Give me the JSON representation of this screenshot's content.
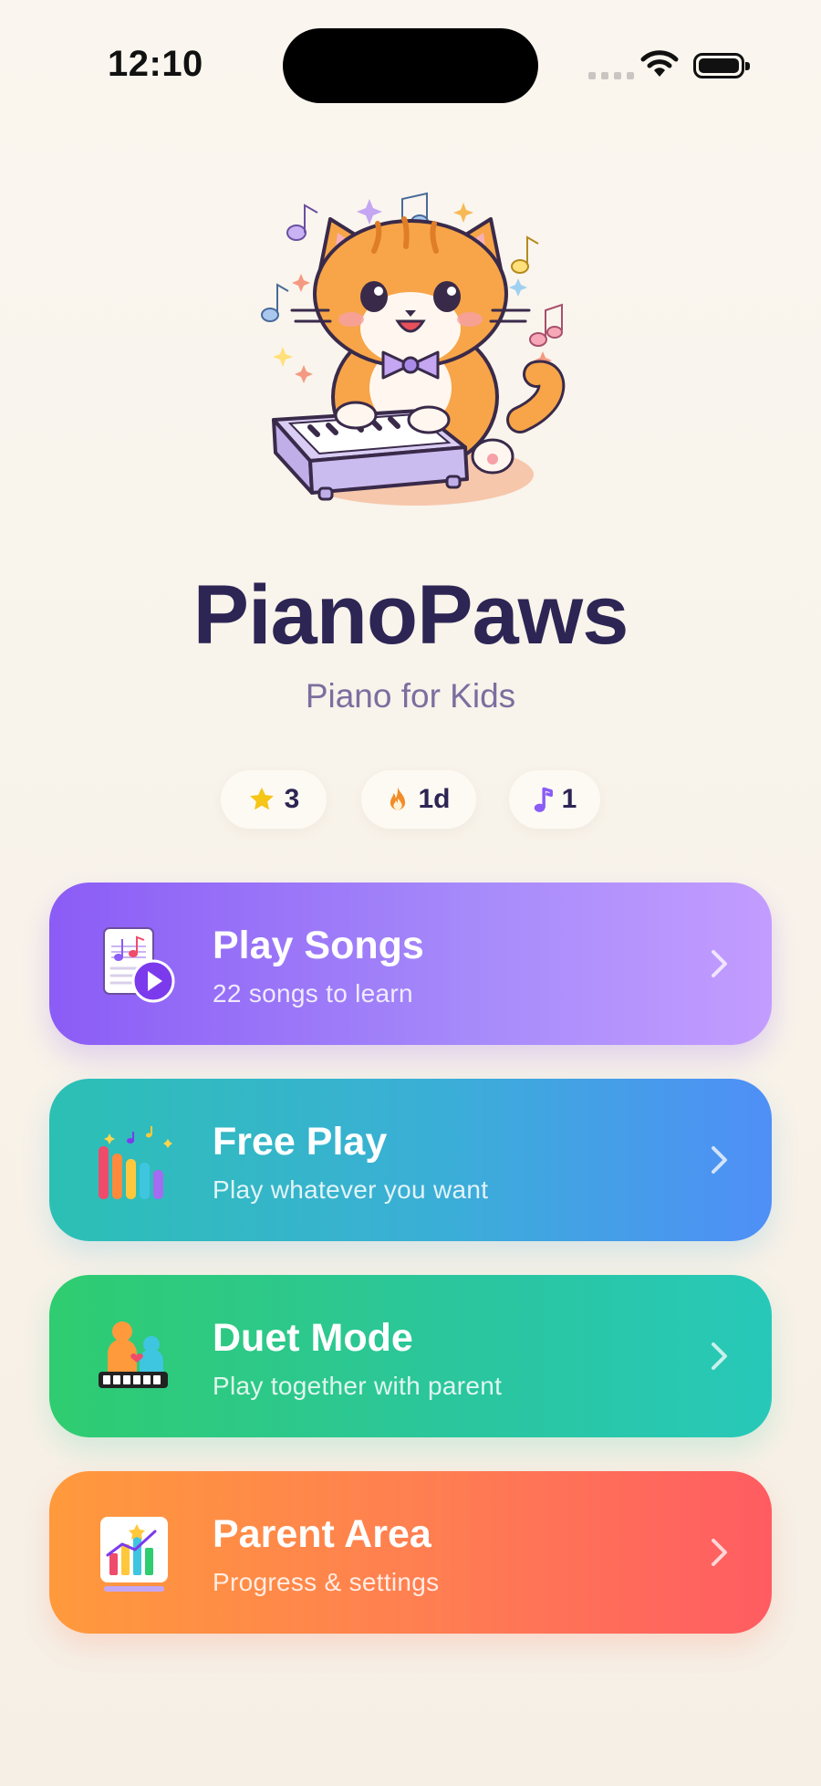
{
  "status_bar": {
    "time": "12:10"
  },
  "app": {
    "title": "PianoPaws",
    "subtitle": "Piano for Kids"
  },
  "stats": [
    {
      "icon": "star-icon",
      "value": "3",
      "color": "#f5c518"
    },
    {
      "icon": "flame-icon",
      "value": "1d",
      "color": "#f28c28"
    },
    {
      "icon": "music-note-icon",
      "value": "1",
      "color": "#8b5cf6"
    }
  ],
  "menu": [
    {
      "icon": "song-sheet-play-icon",
      "title": "Play Songs",
      "subtitle": "22 songs to learn",
      "color": "#8b5cf6"
    },
    {
      "icon": "equalizer-bars-icon",
      "title": "Free Play",
      "subtitle": "Play whatever you want",
      "color": "#3baed8"
    },
    {
      "icon": "parent-child-keyboard-icon",
      "title": "Duet Mode",
      "subtitle": "Play together with parent",
      "color": "#2bc69c"
    },
    {
      "icon": "progress-chart-icon",
      "title": "Parent Area",
      "subtitle": "Progress & settings",
      "color": "#ff7d52"
    }
  ]
}
